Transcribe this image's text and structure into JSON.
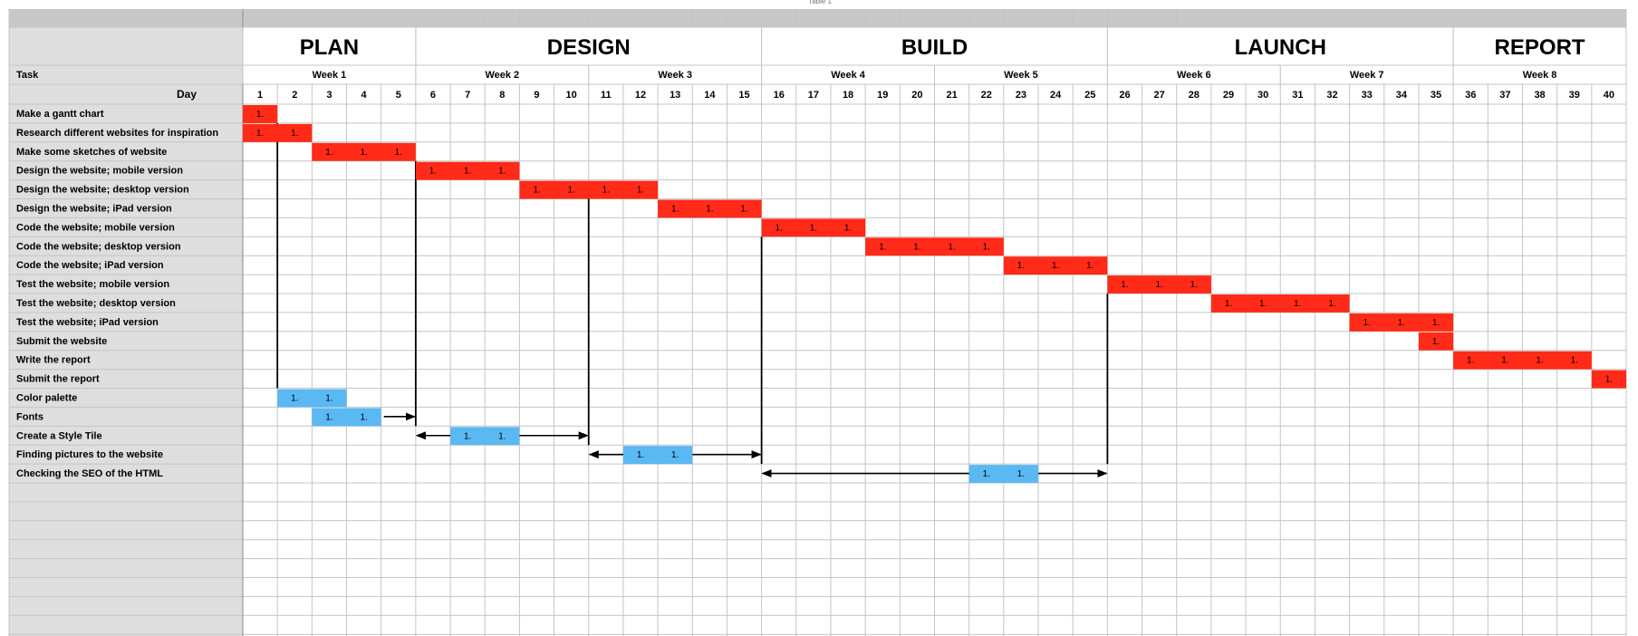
{
  "sheet": {
    "title": "Table 1"
  },
  "headers": {
    "task_label": "Task",
    "day_label": "Day"
  },
  "phases": [
    {
      "name": "PLAN",
      "start": 1,
      "end": 5
    },
    {
      "name": "DESIGN",
      "start": 6,
      "end": 15
    },
    {
      "name": "BUILD",
      "start": 16,
      "end": 25
    },
    {
      "name": "LAUNCH",
      "start": 26,
      "end": 35
    },
    {
      "name": "REPORT",
      "start": 36,
      "end": 40
    }
  ],
  "weeks": [
    {
      "label": "Week 1",
      "start": 1,
      "end": 5
    },
    {
      "label": "Week 2",
      "start": 6,
      "end": 10
    },
    {
      "label": "Week 3",
      "start": 11,
      "end": 15
    },
    {
      "label": "Week 4",
      "start": 16,
      "end": 20
    },
    {
      "label": "Week 5",
      "start": 21,
      "end": 25
    },
    {
      "label": "Week 6",
      "start": 26,
      "end": 30
    },
    {
      "label": "Week 7",
      "start": 31,
      "end": 35
    },
    {
      "label": "Week 8",
      "start": 36,
      "end": 40
    }
  ],
  "colors": {
    "main_task": "#ff2a17",
    "design_task": "#5ab8f2",
    "header_gray": "#dedede",
    "grid": "#c4c4c4"
  },
  "chart_data": {
    "type": "table",
    "x_unit": "day",
    "days": [
      1,
      2,
      3,
      4,
      5,
      6,
      7,
      8,
      9,
      10,
      11,
      12,
      13,
      14,
      15,
      16,
      17,
      18,
      19,
      20,
      21,
      22,
      23,
      24,
      25,
      26,
      27,
      28,
      29,
      30,
      31,
      32,
      33,
      34,
      35,
      36,
      37,
      38,
      39,
      40
    ],
    "cell_label": "1.",
    "tasks": [
      {
        "name": "Make a gantt chart",
        "start": 1,
        "end": 1,
        "kind": "main"
      },
      {
        "name": "Research different websites for inspiration",
        "start": 1,
        "end": 2,
        "kind": "main"
      },
      {
        "name": "Make some sketches of website",
        "start": 3,
        "end": 5,
        "kind": "main"
      },
      {
        "name": "Design the website; mobile version",
        "start": 6,
        "end": 8,
        "kind": "main"
      },
      {
        "name": "Design the website; desktop version",
        "start": 9,
        "end": 12,
        "kind": "main"
      },
      {
        "name": "Design the website; iPad version",
        "start": 13,
        "end": 15,
        "kind": "main"
      },
      {
        "name": "Code the website; mobile version",
        "start": 16,
        "end": 18,
        "kind": "main"
      },
      {
        "name": "Code the website; desktop version",
        "start": 19,
        "end": 22,
        "kind": "main"
      },
      {
        "name": "Code the website; iPad version",
        "start": 23,
        "end": 25,
        "kind": "main"
      },
      {
        "name": "Test the website; mobile version",
        "start": 26,
        "end": 28,
        "kind": "main"
      },
      {
        "name": "Test the website; desktop version",
        "start": 29,
        "end": 32,
        "kind": "main"
      },
      {
        "name": "Test the website; iPad version",
        "start": 33,
        "end": 35,
        "kind": "main"
      },
      {
        "name": "Submit the website",
        "start": 35,
        "end": 35,
        "kind": "main"
      },
      {
        "name": "Write the report",
        "start": 36,
        "end": 39,
        "kind": "main"
      },
      {
        "name": "Submit the report",
        "start": 40,
        "end": 40,
        "kind": "main"
      },
      {
        "name": "Color palette",
        "start": 2,
        "end": 3,
        "kind": "design"
      },
      {
        "name": "Fonts",
        "start": 3,
        "end": 4,
        "kind": "design"
      },
      {
        "name": "Create a Style Tile",
        "start": 7,
        "end": 8,
        "kind": "design"
      },
      {
        "name": "Finding pictures to the website",
        "start": 12,
        "end": 13,
        "kind": "design"
      },
      {
        "name": "Checking the SEO of the HTML",
        "start": 22,
        "end": 23,
        "kind": "design"
      }
    ],
    "dependency_lines": [
      {
        "after_day": 1,
        "from_task": 1,
        "to_task": 15
      },
      {
        "after_day": 5,
        "from_task": 3,
        "to_task": 17
      },
      {
        "after_day": 10,
        "from_task": 5,
        "to_task": 18
      },
      {
        "after_day": 15,
        "from_task": 7,
        "to_task": 19
      },
      {
        "after_day": 25,
        "from_task": 10,
        "to_task": 19
      }
    ],
    "arrows": [
      {
        "row": 16,
        "from_day": 5,
        "to_day": 5,
        "heads": "end"
      },
      {
        "row": 17,
        "from_day": 6,
        "to_day": 10,
        "heads": "both"
      },
      {
        "row": 18,
        "from_day": 11,
        "to_day": 15,
        "heads": "both"
      },
      {
        "row": 19,
        "from_day": 16,
        "to_day": 25,
        "heads": "both"
      }
    ]
  }
}
